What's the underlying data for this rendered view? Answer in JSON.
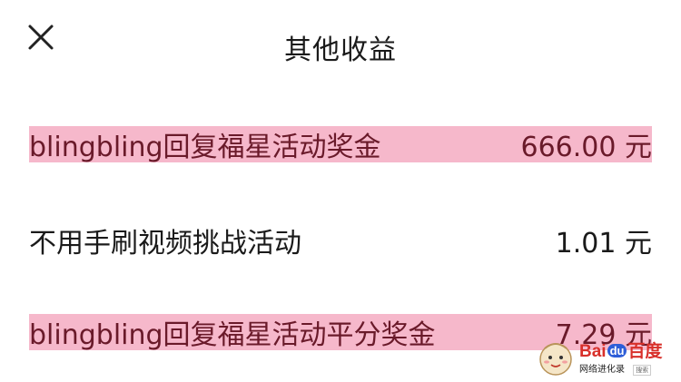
{
  "header": {
    "title": "其他收益",
    "close_icon": "close-icon"
  },
  "income_items": [
    {
      "label": "blingbling回复福星活动奖金",
      "amount": "666.00 元",
      "highlighted": true
    },
    {
      "label": "不用手刷视频挑战活动",
      "amount": "1.01 元",
      "highlighted": false
    },
    {
      "label": "blingbling回复福星活动平分奖金",
      "amount": "7.29 元",
      "highlighted": true
    }
  ],
  "watermark": {
    "brand_prefix": "Bai",
    "brand_du": "du",
    "brand_suffix": "百度",
    "subtitle": "网络进化录",
    "search_tag": "搜索"
  },
  "colors": {
    "highlight_bg": "#f6b8cb",
    "highlight_text": "#6a1a2a",
    "text": "#1a1a1a",
    "baidu_red": "#d8302a",
    "baidu_blue": "#2d5ed8"
  }
}
